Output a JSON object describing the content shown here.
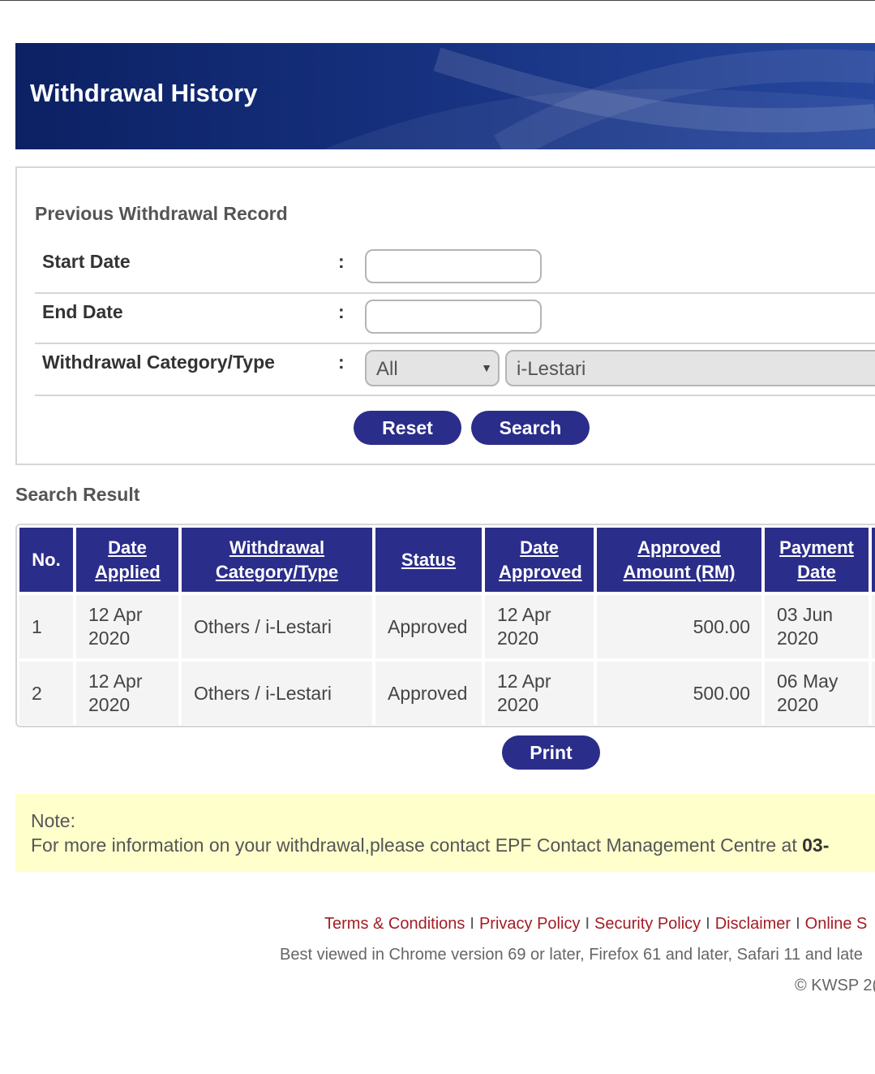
{
  "header": {
    "title": "Withdrawal History"
  },
  "filter": {
    "section_title": "Previous Withdrawal Record",
    "start_date": {
      "label": "Start Date",
      "colon": ":",
      "value": ""
    },
    "end_date": {
      "label": "End Date",
      "colon": ":",
      "value": ""
    },
    "category": {
      "label": "Withdrawal Category/Type",
      "colon": ":",
      "selected": "All",
      "type_value": "i-Lestari"
    },
    "reset_label": "Reset",
    "search_label": "Search"
  },
  "results": {
    "title": "Search Result",
    "columns": [
      "No.",
      "Date Applied",
      "Withdrawal Category/Type",
      "Status",
      "Date Approved",
      "Approved Amount (RM)",
      "Payment Date"
    ],
    "rows": [
      [
        "1",
        "12 Apr 2020",
        "Others / i-Lestari",
        "Approved",
        "12 Apr 2020",
        "500.00",
        "03 Jun 2020"
      ],
      [
        "2",
        "12 Apr 2020",
        "Others / i-Lestari",
        "Approved",
        "12 Apr 2020",
        "500.00",
        "06 May 2020"
      ]
    ],
    "print_label": "Print"
  },
  "note": {
    "label": "Note:",
    "text": "For more information on your withdrawal,please contact EPF Contact Management Centre at ",
    "phone": "03-"
  },
  "footer": {
    "links": [
      "Terms & Conditions",
      "Privacy Policy",
      "Security Policy",
      "Disclaimer",
      "Online S"
    ],
    "separator": "I",
    "browser_note": "Best viewed in Chrome version 69 or later, Firefox 61 and later, Safari 11 and late",
    "copyright": "© KWSP 2("
  },
  "colors": {
    "primary": "#2b2d8a",
    "banner": "#16307e",
    "link": "#a31c24",
    "note_bg": "#ffffcc"
  }
}
